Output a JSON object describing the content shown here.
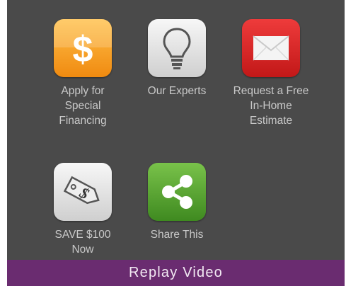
{
  "tiles": [
    {
      "id": "financing",
      "label": "Apply for\nSpecial\nFinancing",
      "icon": "dollar-icon",
      "color": "#f39a1e"
    },
    {
      "id": "experts",
      "label": "Our Experts",
      "icon": "lightbulb-icon",
      "color": "#d9d9d9"
    },
    {
      "id": "estimate",
      "label": "Request a Free\nIn-Home\nEstimate",
      "icon": "envelope-icon",
      "color": "#d42424"
    },
    {
      "id": "save",
      "label": "SAVE $100\nNow",
      "icon": "price-tag-icon",
      "color": "#d9d9d9"
    },
    {
      "id": "share",
      "label": "Share This",
      "icon": "share-icon",
      "color": "#5aa130"
    }
  ],
  "footer": {
    "replay_label": "Replay Video"
  }
}
